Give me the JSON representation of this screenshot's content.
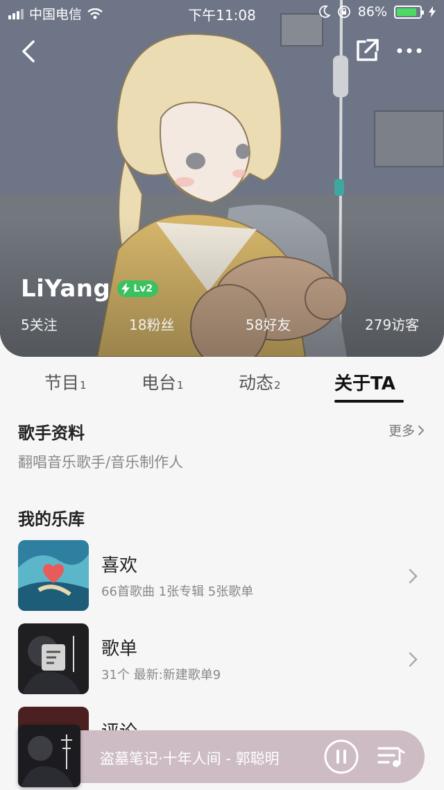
{
  "status_bar": {
    "carrier": "中国电信",
    "time": "下午11:08",
    "battery": "86%",
    "battery_level": 0.86
  },
  "profile": {
    "name": "LiYang",
    "level": "Lv2",
    "stats": [
      {
        "label": "5关注"
      },
      {
        "label": "18粉丝"
      },
      {
        "label": "58好友"
      },
      {
        "label": "279访客"
      }
    ]
  },
  "tabs": [
    {
      "label": "节目",
      "count": "1"
    },
    {
      "label": "电台",
      "count": "1"
    },
    {
      "label": "动态",
      "count": "2"
    },
    {
      "label": "关于TA",
      "count": ""
    }
  ],
  "singer_info": {
    "title": "歌手资料",
    "more": "更多",
    "description": "翻唱音乐歌手/音乐制作人"
  },
  "library": {
    "title": "我的乐库",
    "items": [
      {
        "title": "喜欢",
        "subtitle": "66首歌曲 1张专辑 5张歌单"
      },
      {
        "title": "歌单",
        "subtitle": "31个 最新:新建歌单9"
      },
      {
        "title": "评论",
        "subtitle": ""
      }
    ]
  },
  "player": {
    "now_playing": "盗墓笔记·十年人间 - 郭聪明"
  },
  "colors": {
    "accent_green": "#39c25f",
    "player_bg": "#cdbcc4",
    "battery_green": "#4cd964"
  },
  "icons": [
    "back-arrow-icon",
    "share-icon",
    "more-icon",
    "bolt-icon",
    "heart-icon",
    "playlist-icon",
    "chevron-right-icon",
    "pause-icon",
    "queue-icon"
  ]
}
